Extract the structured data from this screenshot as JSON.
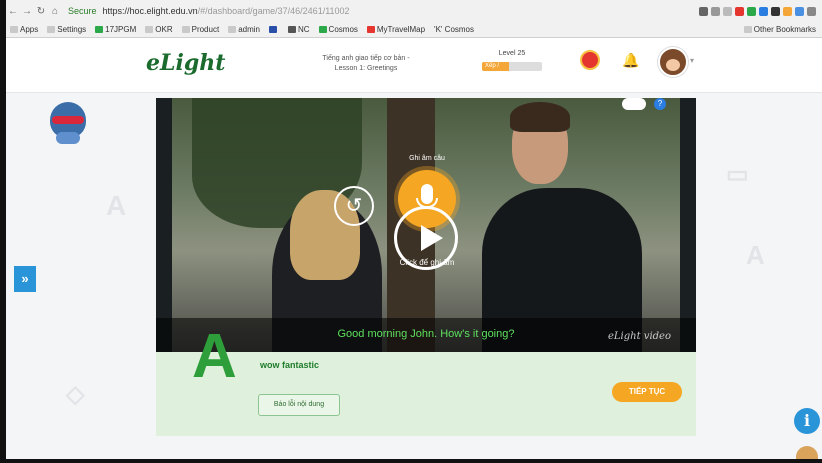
{
  "browser": {
    "secure_label": "Secure",
    "url_host": "https://hoc.elight.edu.vn",
    "url_path": "/#/dashboard/game/37/46/2461/11002",
    "bookmarks": [
      "Apps",
      "Settings",
      "17JPGM",
      "OKR",
      "Product",
      "admin",
      "",
      "NC",
      "Cosmos",
      "MyTravelMap",
      "'K' Cosmos"
    ],
    "bookmarks_right": "Other Bookmarks"
  },
  "header": {
    "logo": "eLight",
    "lesson_line1": "Tiếng anh giao tiếp cơ bản -",
    "lesson_line2": "Lesson 1: Greetings",
    "level": "Level 25",
    "xp_label": "Xếp / Hạng",
    "xp_progress": 0.45
  },
  "video": {
    "record_label": "Ghi âm câu",
    "listen_label": "Click để ghi âm",
    "subtitle": "Good morning John. How's it going?",
    "watermark": "eLight video"
  },
  "answer": {
    "letter": "A",
    "text": "wow fantastic",
    "change_button": "Báo lỗi nội dung",
    "continue_button": "TIẾP TỤC"
  },
  "icons": {
    "replay": "replay-icon",
    "mic": "microphone-icon",
    "play": "play-icon",
    "info": "info-icon"
  },
  "colors": {
    "brand_green": "#1c6b2e",
    "accent_orange": "#f5a623",
    "info_blue": "#2a94d9",
    "subtitle_green": "#5ee05e"
  }
}
